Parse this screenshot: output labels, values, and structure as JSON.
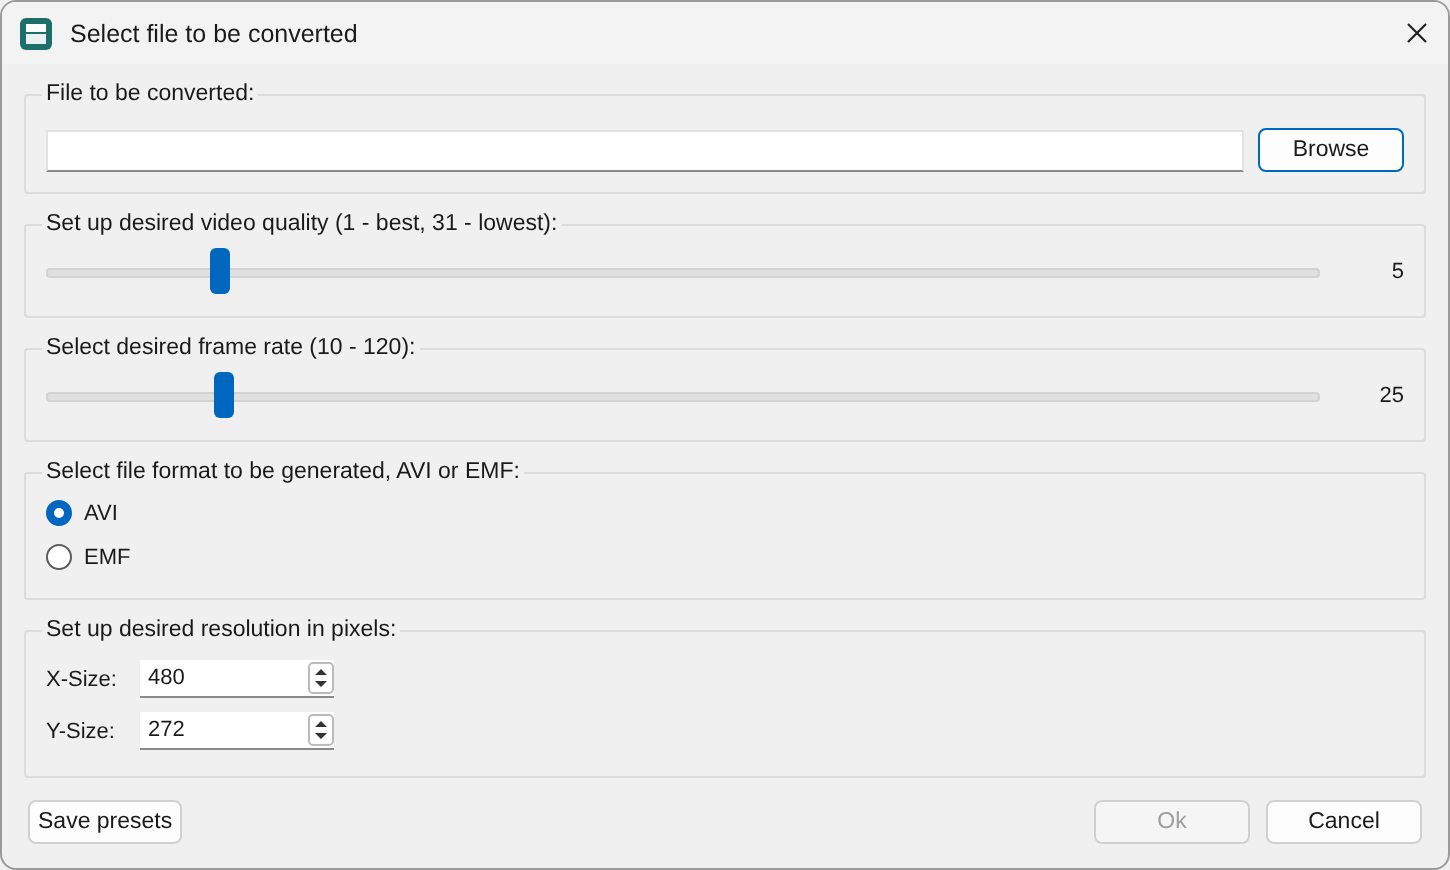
{
  "window": {
    "title": "Select file to be converted"
  },
  "file_group": {
    "label": "File to be converted:",
    "browse_button": "Browse"
  },
  "sliders": [
    {
      "label": "Set up desired video quality (1 - best, 31 - lowest):",
      "level": 0.135,
      "reading": "5"
    },
    {
      "label": "Select desired frame rate (10 - 120):",
      "level": 0.138,
      "reading": "25"
    }
  ],
  "format_group": {
    "label": "Select file format to be generated, AVI or EMF:",
    "options": [
      {
        "label": "AVI",
        "selected": true
      },
      {
        "label": "EMF",
        "selected": false
      }
    ]
  },
  "resolution_group": {
    "label": "Set up desired resolution in pixels:",
    "fields": [
      {
        "label": "X-Size:",
        "value": "480"
      },
      {
        "label": "Y-Size:",
        "value": "272"
      }
    ]
  },
  "buttons": {
    "save": {
      "label": "Save presets"
    },
    "ok": {
      "label": "Ok",
      "disabled": true
    },
    "cancel": {
      "label": "Cancel",
      "disabled": false
    }
  }
}
